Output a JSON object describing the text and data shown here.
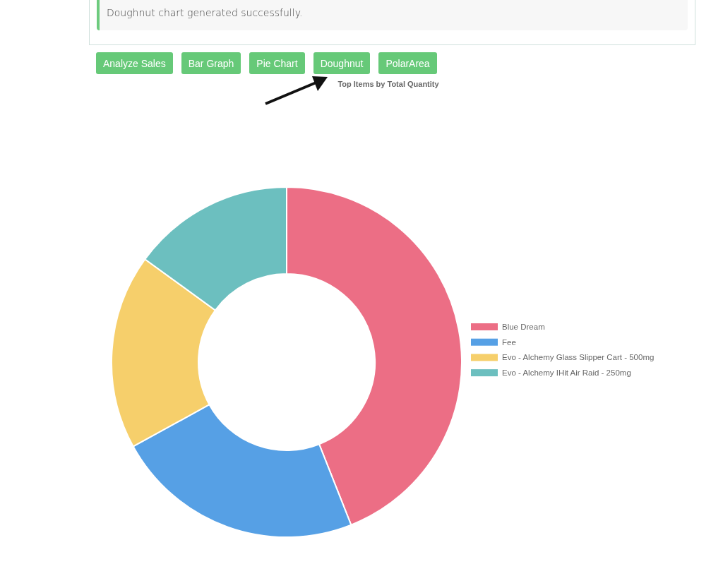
{
  "alert": {
    "message": "Doughnut chart generated successfully."
  },
  "buttons": [
    {
      "label": "Analyze Sales"
    },
    {
      "label": "Bar Graph"
    },
    {
      "label": "Pie Chart"
    },
    {
      "label": "Doughnut"
    },
    {
      "label": "PolarArea"
    }
  ],
  "chart_data": {
    "type": "donut",
    "title": "Top Items by Total Quantity",
    "categories": [
      "Blue Dream",
      "Fee",
      "Evo - Alchemy Glass Slipper Cart - 500mg",
      "Evo - Alchemy IHit Air Raid - 250mg"
    ],
    "colors": [
      "#ec6e85",
      "#56a0e5",
      "#f6cf6b",
      "#6cbfbf"
    ],
    "values": [
      44,
      23,
      18,
      15
    ],
    "legend": "right"
  }
}
